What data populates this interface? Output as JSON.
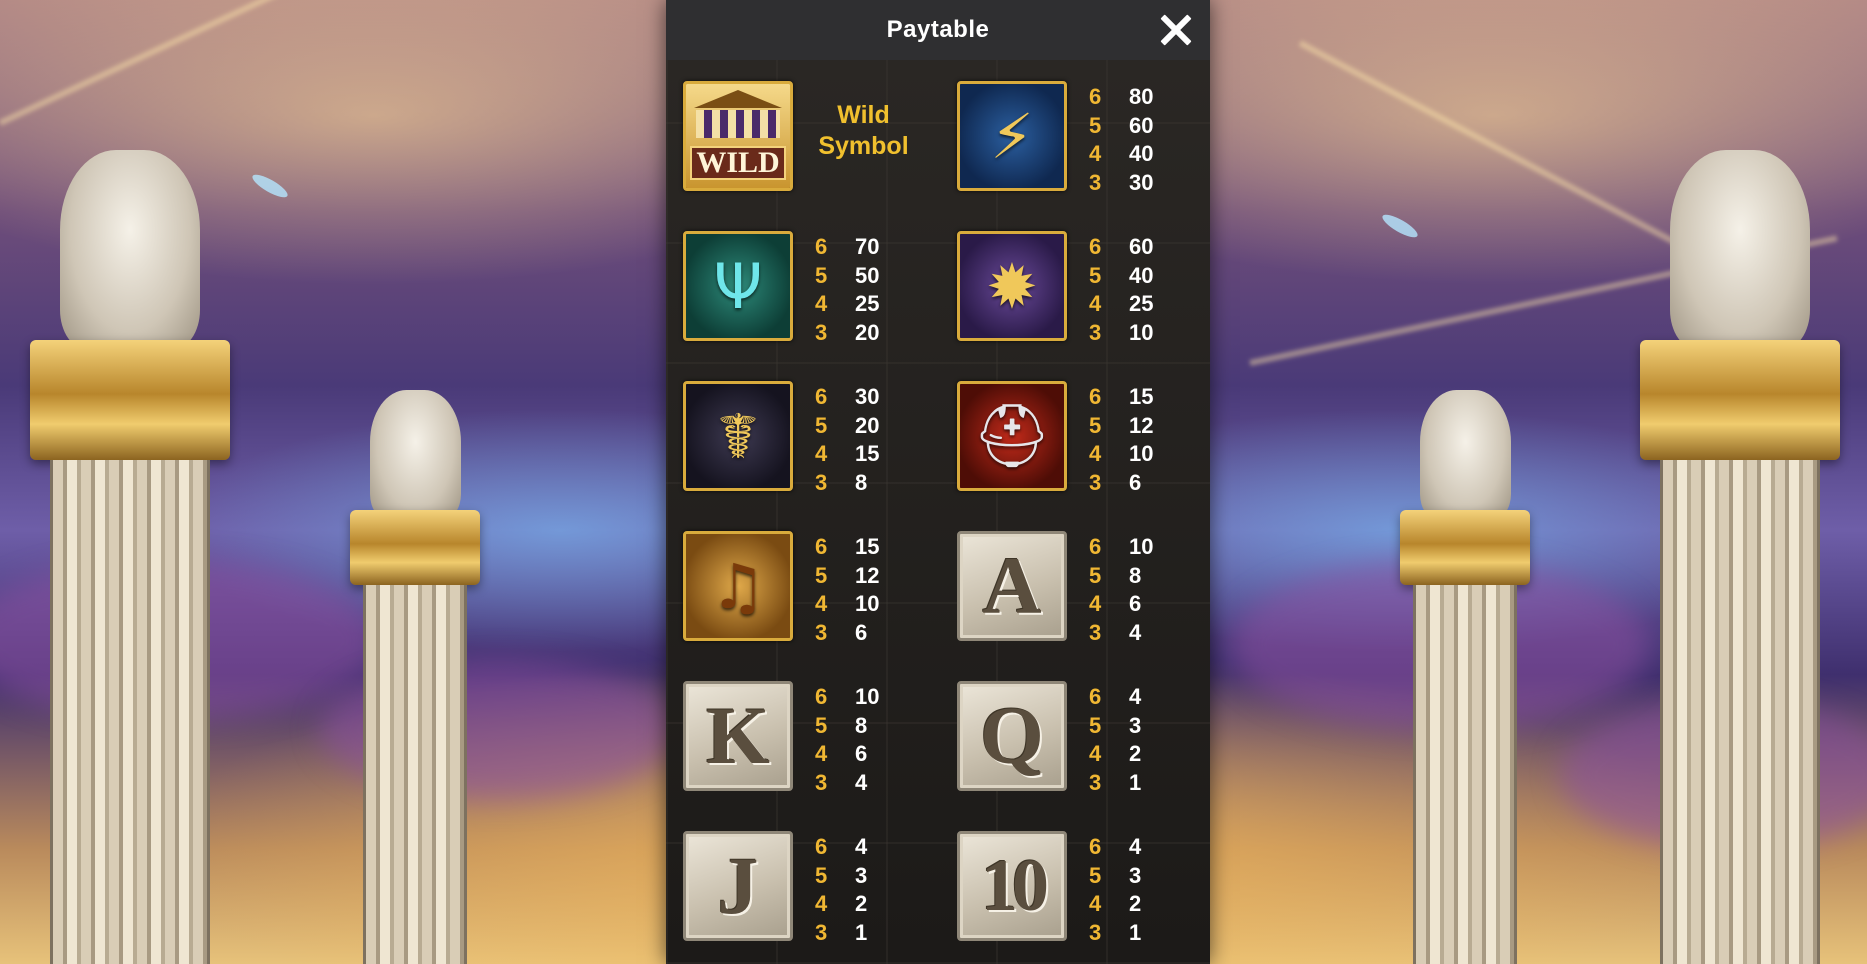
{
  "header": {
    "title": "Paytable",
    "close_icon": "close-icon"
  },
  "colors": {
    "count": "#f0b733",
    "value": "#ffffff",
    "wild_label": "#f0c02e",
    "header_bg": "#2f2f31",
    "panel_bg": "#1e1c1b"
  },
  "wild": {
    "tile_text": "WILD",
    "label_line1": "Wild",
    "label_line2": "Symbol"
  },
  "symbols": [
    {
      "icon": "zeus-fist-lightning-icon",
      "pays": [
        {
          "count": "6",
          "value": "80"
        },
        {
          "count": "5",
          "value": "60"
        },
        {
          "count": "4",
          "value": "40"
        },
        {
          "count": "3",
          "value": "30"
        }
      ]
    },
    {
      "icon": "trident-icon",
      "pays": [
        {
          "count": "6",
          "value": "70"
        },
        {
          "count": "5",
          "value": "50"
        },
        {
          "count": "4",
          "value": "25"
        },
        {
          "count": "3",
          "value": "20"
        }
      ]
    },
    {
      "icon": "owl-shield-icon",
      "pays": [
        {
          "count": "6",
          "value": "60"
        },
        {
          "count": "5",
          "value": "40"
        },
        {
          "count": "4",
          "value": "25"
        },
        {
          "count": "3",
          "value": "10"
        }
      ]
    },
    {
      "icon": "caduceus-icon",
      "pays": [
        {
          "count": "6",
          "value": "30"
        },
        {
          "count": "5",
          "value": "20"
        },
        {
          "count": "4",
          "value": "15"
        },
        {
          "count": "3",
          "value": "8"
        }
      ]
    },
    {
      "icon": "spartan-helmet-icon",
      "pays": [
        {
          "count": "6",
          "value": "15"
        },
        {
          "count": "5",
          "value": "12"
        },
        {
          "count": "4",
          "value": "10"
        },
        {
          "count": "3",
          "value": "6"
        }
      ]
    },
    {
      "icon": "lyre-icon",
      "pays": [
        {
          "count": "6",
          "value": "15"
        },
        {
          "count": "5",
          "value": "12"
        },
        {
          "count": "4",
          "value": "10"
        },
        {
          "count": "3",
          "value": "6"
        }
      ]
    },
    {
      "letter": "A",
      "pays": [
        {
          "count": "6",
          "value": "10"
        },
        {
          "count": "5",
          "value": "8"
        },
        {
          "count": "4",
          "value": "6"
        },
        {
          "count": "3",
          "value": "4"
        }
      ]
    },
    {
      "letter": "K",
      "pays": [
        {
          "count": "6",
          "value": "10"
        },
        {
          "count": "5",
          "value": "8"
        },
        {
          "count": "4",
          "value": "6"
        },
        {
          "count": "3",
          "value": "4"
        }
      ]
    },
    {
      "letter": "Q",
      "pays": [
        {
          "count": "6",
          "value": "4"
        },
        {
          "count": "5",
          "value": "3"
        },
        {
          "count": "4",
          "value": "2"
        },
        {
          "count": "3",
          "value": "1"
        }
      ]
    },
    {
      "letter": "J",
      "pays": [
        {
          "count": "6",
          "value": "4"
        },
        {
          "count": "5",
          "value": "3"
        },
        {
          "count": "4",
          "value": "2"
        },
        {
          "count": "3",
          "value": "1"
        }
      ]
    },
    {
      "letter": "10",
      "pays": [
        {
          "count": "6",
          "value": "4"
        },
        {
          "count": "5",
          "value": "3"
        },
        {
          "count": "4",
          "value": "2"
        },
        {
          "count": "3",
          "value": "1"
        }
      ]
    }
  ]
}
